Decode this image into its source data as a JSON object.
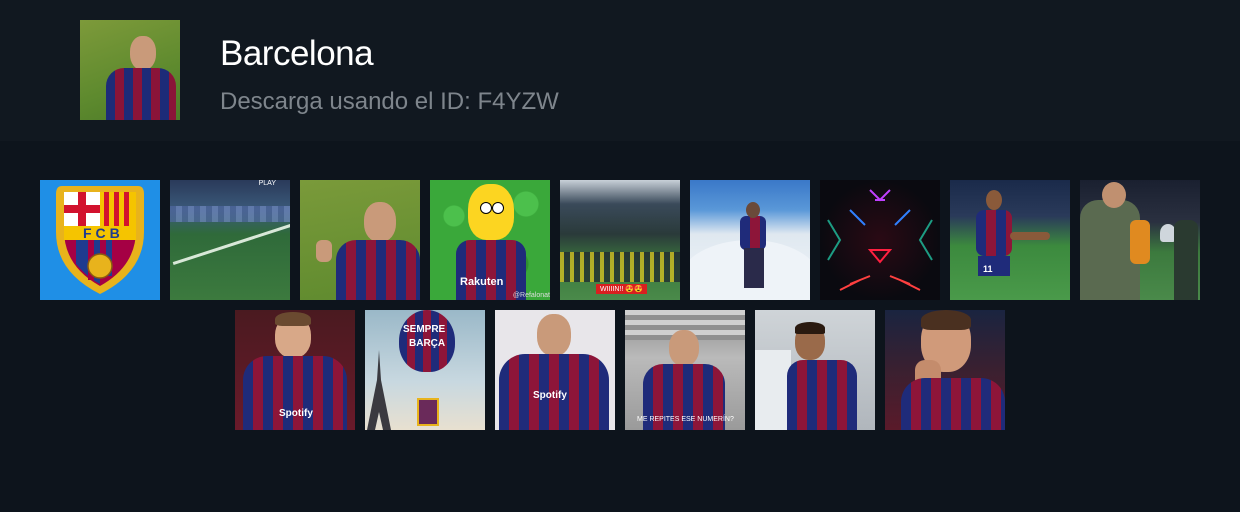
{
  "header": {
    "title": "Barcelona",
    "subtitle": "Descarga usando el ID: F4YZW"
  },
  "colors": {
    "background": "#0d141c",
    "header_background": "#111820",
    "title_color": "#ffffff",
    "subtitle_color": "#7e858c",
    "barca_blue": "#1f2b7a",
    "barca_garnet": "#8d1539"
  },
  "gifs": {
    "row1": [
      "fcb-crest",
      "stadium-play",
      "lewandowski-gesture",
      "homer-barca-shirt",
      "fans-celebration",
      "snow-player",
      "neon-lights",
      "player-11-celebrating",
      "players-with-trophy"
    ],
    "row2": [
      "young-player-spotify-shirt",
      "sempre-barca-balloon",
      "lewandowski-new-kit",
      "me-repites-ese-numerin",
      "child-barca-shirt",
      "messi-kiss"
    ]
  },
  "captions": {
    "crest_text": "FCB",
    "stadium_play": "PLAY",
    "homer_shirt": "Rakuten",
    "homer_credit": "@Refalonat",
    "fans_banner": "WIIIIN!! 😍😍",
    "player_number": "11",
    "balloon_text_1": "SEMPRE",
    "balloon_text_2": "BARÇA",
    "spotify": "Spotify",
    "subtitle_quote": "ME REPITES ESE NUMERÍN?"
  }
}
